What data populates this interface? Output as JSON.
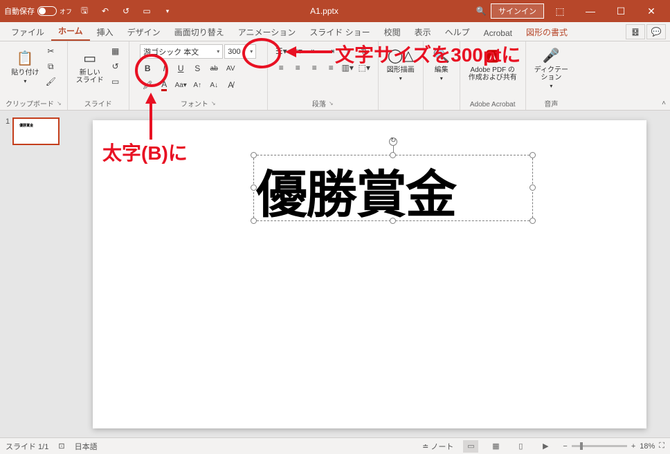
{
  "titlebar": {
    "autosave_label": "自動保存",
    "autosave_state": "オフ",
    "filename": "A1.pptx",
    "signin": "サインイン"
  },
  "tabs": {
    "file": "ファイル",
    "home": "ホーム",
    "insert": "挿入",
    "design": "デザイン",
    "transitions": "画面切り替え",
    "animations": "アニメーション",
    "slideshow": "スライド ショー",
    "review": "校閲",
    "view": "表示",
    "help": "ヘルプ",
    "acrobat": "Acrobat",
    "shapeformat": "図形の書式"
  },
  "ribbon": {
    "clipboard": {
      "label": "クリップボード",
      "paste": "貼り付け"
    },
    "slides": {
      "label": "スライド",
      "newslide": "新しい\nスライド"
    },
    "font": {
      "label": "フォント",
      "name": "游ゴシック 本文",
      "size": "300",
      "bold": "B",
      "italic": "I",
      "underline": "U",
      "strike": "S",
      "shadow": "ab",
      "spacing": "AV"
    },
    "paragraph": {
      "label": "段落"
    },
    "drawing": {
      "label": "図形描画"
    },
    "editing": {
      "label": "編集"
    },
    "adobe": {
      "group": "Adobe Acrobat",
      "label": "Adobe PDF の\n作成および共有"
    },
    "voice": {
      "group": "音声",
      "label": "ディクテー\nション"
    }
  },
  "thumb": {
    "num": "1"
  },
  "slide": {
    "text": "優勝賞金"
  },
  "status": {
    "slide": "スライド 1/1",
    "lang": "日本語",
    "notes": "ノート",
    "zoom": "18%"
  },
  "annotations": {
    "fontsize": "文字サイズを300ptに",
    "bold": "太字(B)に"
  }
}
